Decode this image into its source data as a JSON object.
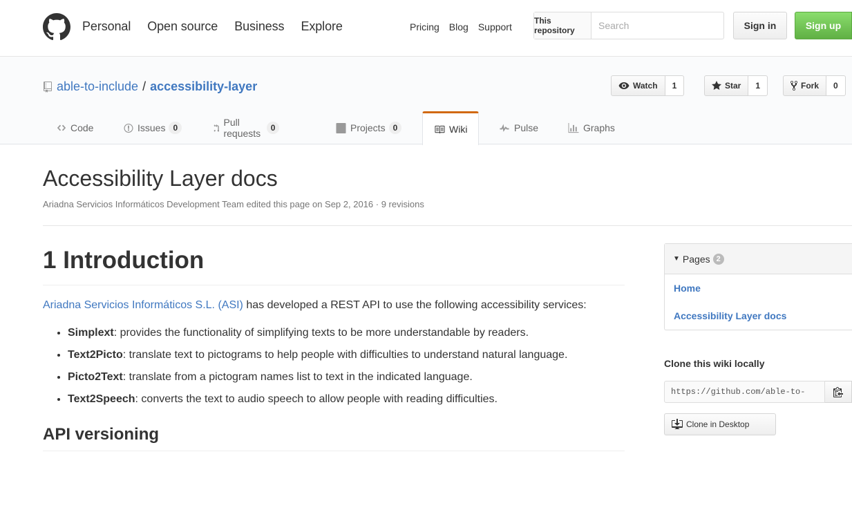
{
  "header": {
    "nav": [
      "Personal",
      "Open source",
      "Business",
      "Explore"
    ],
    "subnav": [
      "Pricing",
      "Blog",
      "Support"
    ],
    "search_scope": "This repository",
    "search_placeholder": "Search",
    "sign_in": "Sign in",
    "sign_up": "Sign up"
  },
  "repo": {
    "owner": "able-to-include",
    "separator": "/",
    "name": "accessibility-layer",
    "watch_label": "Watch",
    "watch_count": "1",
    "star_label": "Star",
    "star_count": "1",
    "fork_label": "Fork",
    "fork_count": "0"
  },
  "tabs": {
    "code": "Code",
    "issues": "Issues",
    "issues_count": "0",
    "pulls": "Pull requests",
    "pulls_count": "0",
    "projects": "Projects",
    "projects_count": "0",
    "wiki": "Wiki",
    "pulse": "Pulse",
    "graphs": "Graphs"
  },
  "wiki": {
    "title": "Accessibility Layer docs",
    "meta": "Ariadna Servicios Informáticos Development Team edited this page on Sep 2, 2016 · 9 revisions",
    "h1": "1 Introduction",
    "intro_link": "Ariadna Servicios Informáticos S.L. (ASI)",
    "intro_text": " has developed a REST API to use the following accessibility services:",
    "services": [
      {
        "name": "Simplext",
        "desc": ": provides the functionality of simplifying texts to be more understandable by readers."
      },
      {
        "name": "Text2Picto",
        "desc": ": translate text to pictograms to help people with difficulties to understand natural language."
      },
      {
        "name": "Picto2Text",
        "desc": ": translate from a pictogram names list to text in the indicated language."
      },
      {
        "name": "Text2Speech",
        "desc": ": converts the text to audio speech to allow people with reading difficulties."
      }
    ],
    "h2": "API versioning"
  },
  "sidebar": {
    "pages_label": "Pages",
    "pages_count": "2",
    "pages": [
      "Home",
      "Accessibility Layer docs"
    ],
    "clone_label": "Clone this wiki locally",
    "clone_url": "https://github.com/able-to-",
    "clone_desktop": "Clone in Desktop"
  },
  "colors": {
    "link": "#4078c0",
    "signup_green": "#60b044",
    "tab_accent": "#d26911"
  }
}
